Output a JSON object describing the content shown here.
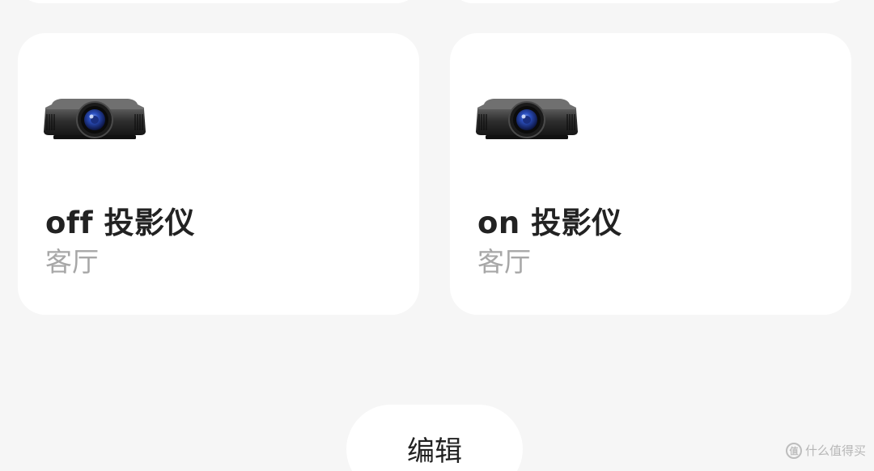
{
  "devices": [
    {
      "icon": "projector-icon",
      "name": "off 投影仪",
      "room": "客厅"
    },
    {
      "icon": "projector-icon",
      "name": "on 投影仪",
      "room": "客厅"
    }
  ],
  "edit_button": {
    "label": "编辑"
  },
  "watermark": {
    "logo_text": "值",
    "text": "什么值得买"
  },
  "colors": {
    "background": "#f6f6f6",
    "card": "#ffffff",
    "name_text": "#222222",
    "room_text": "#a7a7a7",
    "lens_blue": "#2b4fbf"
  }
}
